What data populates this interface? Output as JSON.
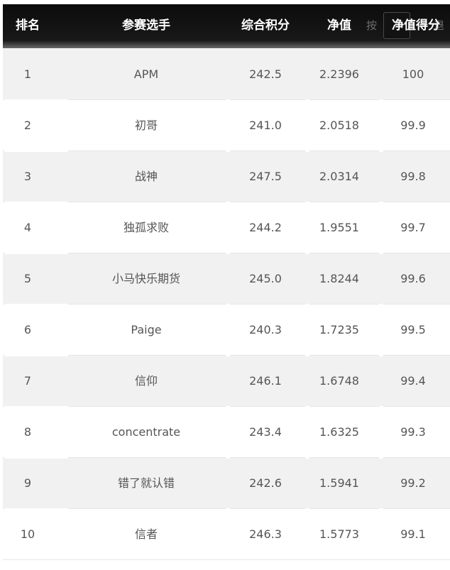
{
  "header": {
    "rank": "排名",
    "participant": "参赛选手",
    "total_score": "综合积分",
    "net_value": "净值",
    "sort_hint_left": "按",
    "sort_hint_right": "退",
    "net_value_score": "净值得分"
  },
  "rows": [
    {
      "rank": "1",
      "name": "APM",
      "score": "242.5",
      "net": "2.2396",
      "net_score": "100"
    },
    {
      "rank": "2",
      "name": "初哥",
      "score": "241.0",
      "net": "2.0518",
      "net_score": "99.9"
    },
    {
      "rank": "3",
      "name": "战神",
      "score": "247.5",
      "net": "2.0314",
      "net_score": "99.8"
    },
    {
      "rank": "4",
      "name": "独孤求败",
      "score": "244.2",
      "net": "1.9551",
      "net_score": "99.7"
    },
    {
      "rank": "5",
      "name": "小马快乐期货",
      "score": "245.0",
      "net": "1.8244",
      "net_score": "99.6"
    },
    {
      "rank": "6",
      "name": "Paige",
      "score": "240.3",
      "net": "1.7235",
      "net_score": "99.5"
    },
    {
      "rank": "7",
      "name": "信仰",
      "score": "246.1",
      "net": "1.6748",
      "net_score": "99.4"
    },
    {
      "rank": "8",
      "name": "concentrate",
      "score": "243.4",
      "net": "1.6325",
      "net_score": "99.3"
    },
    {
      "rank": "9",
      "name": "错了就认错",
      "score": "242.6",
      "net": "1.5941",
      "net_score": "99.2"
    },
    {
      "rank": "10",
      "name": "信者",
      "score": "246.3",
      "net": "1.5773",
      "net_score": "99.1"
    }
  ]
}
